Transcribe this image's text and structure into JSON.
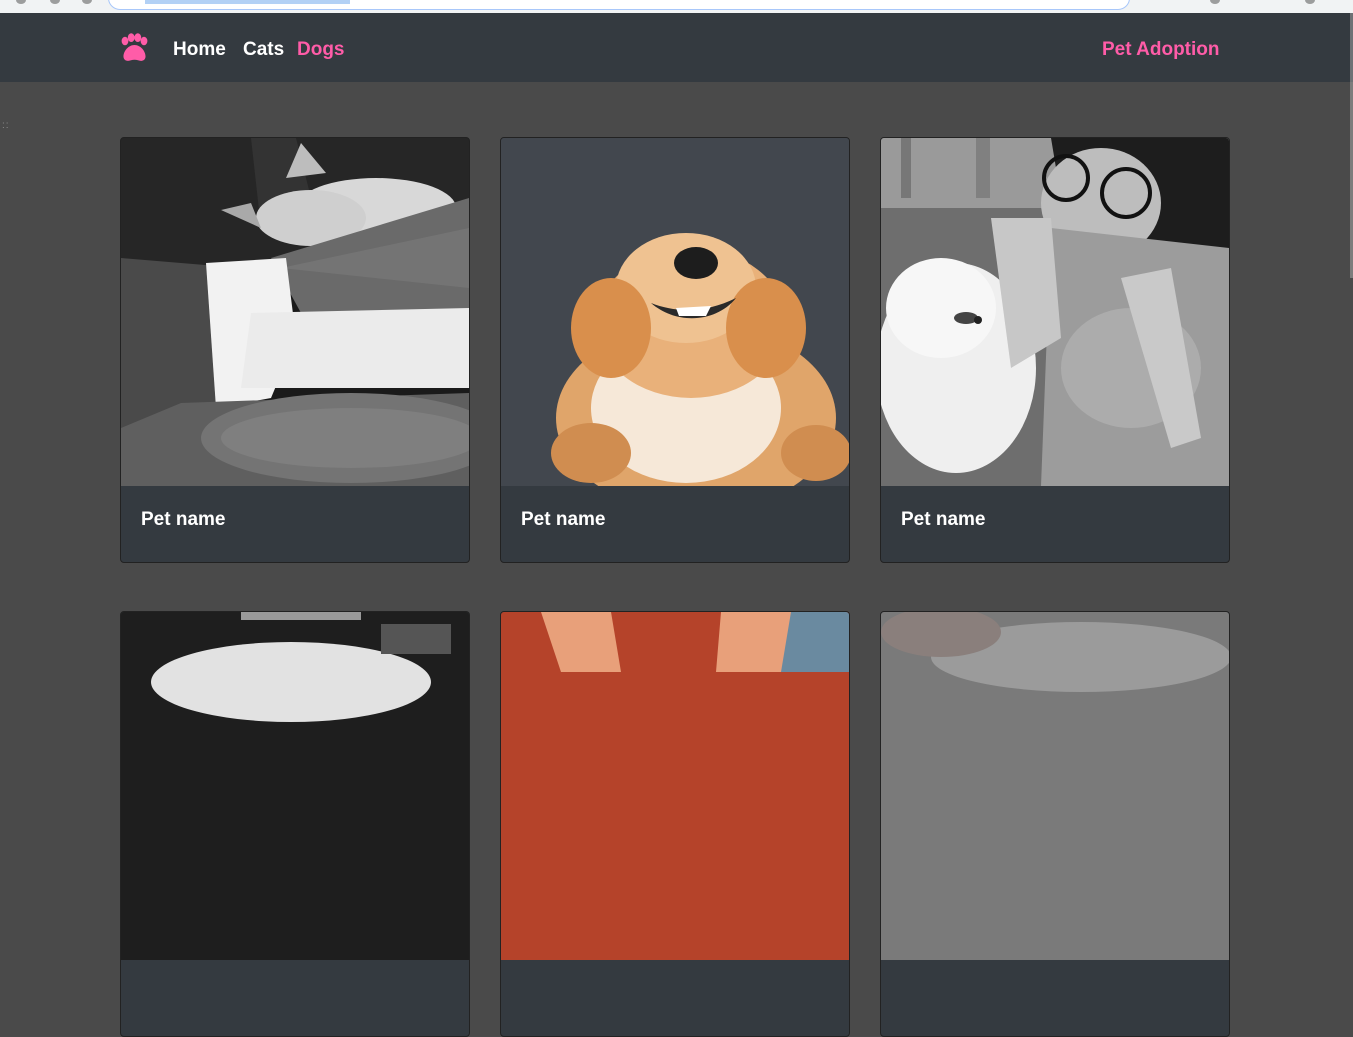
{
  "navbar": {
    "brand_icon": "paw-icon",
    "links": [
      {
        "label": "Home"
      },
      {
        "label": "Cats"
      },
      {
        "label": "Dogs"
      }
    ],
    "brand_text": "Pet Adoption",
    "accent_color": "#ff5ca8",
    "background_color": "#343a40"
  },
  "cards": [
    {
      "name": "Pet name",
      "image": "sleeping-dog-on-lap-photo"
    },
    {
      "name": "Pet name",
      "image": "golden-retriever-on-back-photo"
    },
    {
      "name": "Pet name",
      "image": "woman-holding-pomeranian-photo"
    },
    {
      "name": "",
      "image": "dog-photo-partial"
    },
    {
      "name": "",
      "image": "dog-ears-photo-partial"
    },
    {
      "name": "",
      "image": "dog-paw-photo-partial"
    }
  ]
}
